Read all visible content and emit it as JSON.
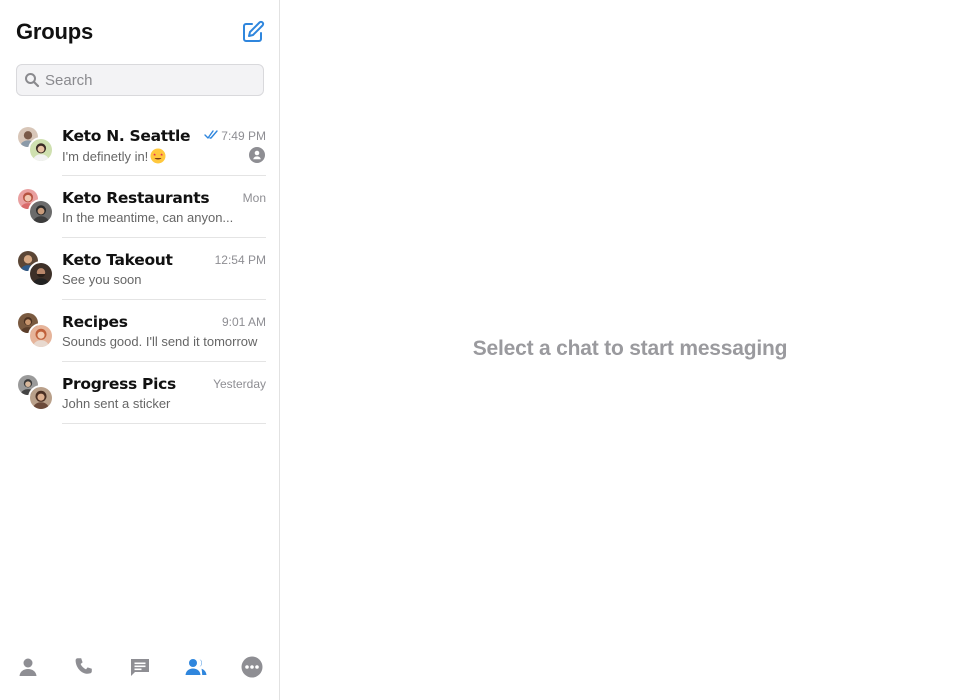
{
  "sidebar": {
    "title": "Groups",
    "search": {
      "placeholder": "Search",
      "value": ""
    },
    "chats": [
      {
        "name": "Keto N. Seattle",
        "time": "7:49 PM",
        "preview": "I'm definetly in!",
        "read_receipt": true,
        "emoji": "star-struck",
        "unread_icon": true
      },
      {
        "name": "Keto Restaurants",
        "time": "Mon",
        "preview": "In the meantime, can anyon..."
      },
      {
        "name": "Keto Takeout",
        "time": "12:54 PM",
        "preview": "See you soon"
      },
      {
        "name": "Recipes",
        "time": "9:01 AM",
        "preview": "Sounds good. I'll send it tomorrow"
      },
      {
        "name": "Progress Pics",
        "time": "Yesterday",
        "preview": "John sent a sticker"
      }
    ],
    "tabs": [
      "contacts-icon",
      "phone-icon",
      "chats-icon",
      "groups-icon",
      "more-icon"
    ],
    "active_tab": "groups-icon"
  },
  "main": {
    "placeholder": "Select a chat to start messaging"
  },
  "colors": {
    "accent": "#2f86dd",
    "muted_icon": "#8e8e93",
    "placeholder_text": "#9a9a9e"
  }
}
